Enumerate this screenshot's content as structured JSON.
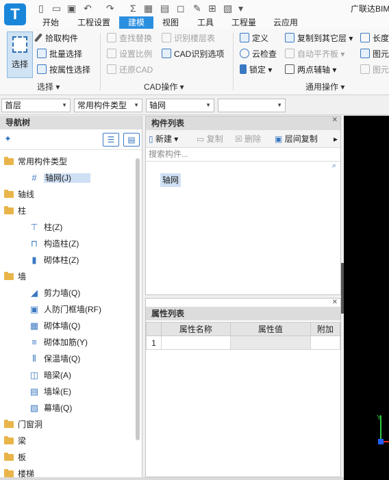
{
  "app": {
    "title": "广联达BIM",
    "logo_glyph": "T"
  },
  "quick_access": {
    "sigma": "Σ"
  },
  "ribbon_tabs": [
    "开始",
    "工程设置",
    "建模",
    "视图",
    "工具",
    "工程量",
    "云应用"
  ],
  "active_tab": "建模",
  "ribbon": {
    "select_group": {
      "select_label": "选择",
      "pick_label": "拾取构件",
      "batch_label": "批量选择",
      "attr_label": "按属性选择",
      "group_label": "选择"
    },
    "cad_group": {
      "find_replace": "查找替换",
      "identify_floor": "识别楼层表",
      "set_scale": "设置比例",
      "cad_options": "CAD识别选项",
      "restore_cad": "还原CAD",
      "group_label": "CAD操作"
    },
    "general_group": {
      "define": "定义",
      "copy_other": "复制到其它层",
      "length": "长度",
      "cloud_check": "云检查",
      "auto_floor": "自动平齐板",
      "elem1": "图元",
      "lock": "锁定",
      "two_point": "两点辅轴",
      "elem2": "图元",
      "group_label": "通用操作"
    }
  },
  "toolbar": {
    "floor": "首层",
    "type": "常用构件类型",
    "component": "轴网",
    "empty": ""
  },
  "nav": {
    "title": "导航树",
    "items": [
      {
        "label": "常用构件类型",
        "kind": "folder"
      },
      {
        "label": "轴网(J)",
        "kind": "child",
        "icon": "#"
      },
      {
        "label": "轴线",
        "kind": "folder"
      },
      {
        "label": "柱",
        "kind": "folder"
      },
      {
        "label": "柱(Z)",
        "kind": "child",
        "icon": "⊤"
      },
      {
        "label": "构造柱(Z)",
        "kind": "child",
        "icon": "⊓"
      },
      {
        "label": "砌体柱(Z)",
        "kind": "child",
        "icon": "▮"
      },
      {
        "label": "墙",
        "kind": "folder"
      },
      {
        "label": "剪力墙(Q)",
        "kind": "child",
        "icon": "◢"
      },
      {
        "label": "人防门框墙(RF)",
        "kind": "child",
        "icon": "▣"
      },
      {
        "label": "砌体墙(Q)",
        "kind": "child",
        "icon": "▦"
      },
      {
        "label": "砌体加筋(Y)",
        "kind": "child",
        "icon": "≡"
      },
      {
        "label": "保温墙(Q)",
        "kind": "child",
        "icon": "⫴"
      },
      {
        "label": "暗梁(A)",
        "kind": "child",
        "icon": "◫"
      },
      {
        "label": "墙垛(E)",
        "kind": "child",
        "icon": "▤"
      },
      {
        "label": "幕墙(Q)",
        "kind": "child",
        "icon": "▧"
      },
      {
        "label": "门窗洞",
        "kind": "folder"
      },
      {
        "label": "梁",
        "kind": "folder"
      },
      {
        "label": "板",
        "kind": "folder"
      },
      {
        "label": "楼梯",
        "kind": "folder"
      }
    ]
  },
  "component_list": {
    "title": "构件列表",
    "new_label": "新建",
    "copy_label": "复制",
    "delete_label": "删除",
    "floor_copy_label": "层间复制",
    "search_placeholder": "搜索构件...",
    "selected_item": "轴网"
  },
  "property_list": {
    "title": "属性列表",
    "columns": [
      "属性名称",
      "属性值",
      "附加"
    ],
    "rows": [
      [
        "1",
        "",
        "",
        ""
      ]
    ]
  },
  "colors": {
    "accent": "#2b8fe0",
    "canvas": "#000000"
  }
}
